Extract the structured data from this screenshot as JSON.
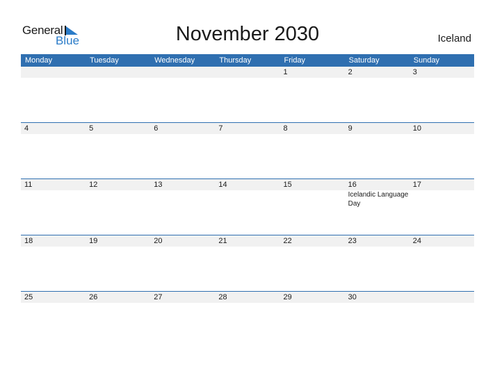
{
  "logo": {
    "line1": "General",
    "line2": "Blue"
  },
  "title": "November 2030",
  "country": "Iceland",
  "colors": {
    "accent": "#2f6fb0",
    "band": "#f1f1f1",
    "logo_blue": "#2a7bc8"
  },
  "weekdays": [
    "Monday",
    "Tuesday",
    "Wednesday",
    "Thursday",
    "Friday",
    "Saturday",
    "Sunday"
  ],
  "weeks": [
    {
      "days": [
        "",
        "",
        "",
        "",
        "1",
        "2",
        "3"
      ],
      "events": [
        "",
        "",
        "",
        "",
        "",
        "",
        ""
      ]
    },
    {
      "days": [
        "4",
        "5",
        "6",
        "7",
        "8",
        "9",
        "10"
      ],
      "events": [
        "",
        "",
        "",
        "",
        "",
        "",
        ""
      ]
    },
    {
      "days": [
        "11",
        "12",
        "13",
        "14",
        "15",
        "16",
        "17"
      ],
      "events": [
        "",
        "",
        "",
        "",
        "",
        "Icelandic Language Day",
        ""
      ]
    },
    {
      "days": [
        "18",
        "19",
        "20",
        "21",
        "22",
        "23",
        "24"
      ],
      "events": [
        "",
        "",
        "",
        "",
        "",
        "",
        ""
      ]
    },
    {
      "days": [
        "25",
        "26",
        "27",
        "28",
        "29",
        "30",
        ""
      ],
      "events": [
        "",
        "",
        "",
        "",
        "",
        "",
        ""
      ]
    }
  ]
}
